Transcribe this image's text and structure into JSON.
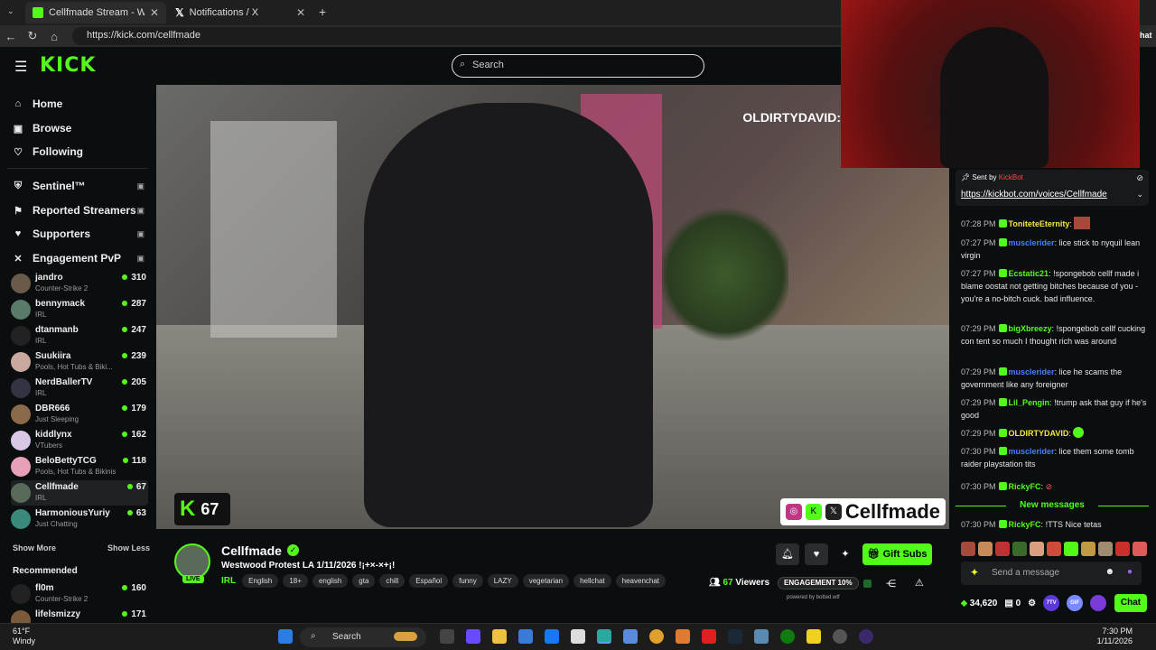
{
  "browser": {
    "tabs": [
      {
        "title": "Cellfmade Stream - Watch Li"
      },
      {
        "title": "Notifications / X"
      }
    ],
    "url": "https://kick.com/cellfmade",
    "right_label": "hat"
  },
  "header": {
    "logo": "KICK",
    "search_placeholder": "Search"
  },
  "sidebar": {
    "nav": [
      {
        "label": "Home",
        "icon": "home-icon"
      },
      {
        "label": "Browse",
        "icon": "browse-icon"
      },
      {
        "label": "Following",
        "icon": "heart-icon"
      }
    ],
    "extensions": [
      {
        "label": "Sentinel™",
        "icon": "shield-icon"
      },
      {
        "label": "Reported Streamers",
        "icon": "flag-icon"
      },
      {
        "label": "Supporters",
        "icon": "heart-icon"
      },
      {
        "label": "Engagement PvP",
        "icon": "swords-icon"
      }
    ],
    "channels": [
      {
        "name": "jandro",
        "category": "Counter-Strike 2",
        "viewers": "310"
      },
      {
        "name": "bennymack",
        "category": "IRL",
        "viewers": "287"
      },
      {
        "name": "dtanmanb",
        "category": "IRL",
        "viewers": "247"
      },
      {
        "name": "Suukiira",
        "category": "Pools, Hot Tubs & Biki...",
        "viewers": "239"
      },
      {
        "name": "NerdBallerTV",
        "category": "IRL",
        "viewers": "205"
      },
      {
        "name": "DBR666",
        "category": "Just Sleeping",
        "viewers": "179"
      },
      {
        "name": "kiddlynx",
        "category": "VTubers",
        "viewers": "162"
      },
      {
        "name": "BeloBettyTCG",
        "category": "Pools, Hot Tubs & Bikinis",
        "viewers": "118"
      },
      {
        "name": "Cellfmade",
        "category": "IRL",
        "viewers": "67"
      },
      {
        "name": "HarmoniousYuriy",
        "category": "Just Chatting",
        "viewers": "63"
      }
    ],
    "show_more": "Show More",
    "show_less": "Show Less",
    "recommended_label": "Recommended",
    "recommended": [
      {
        "name": "fl0m",
        "category": "Counter-Strike 2",
        "viewers": "160"
      },
      {
        "name": "lifelsmizzy",
        "category": "",
        "viewers": "171"
      }
    ]
  },
  "video": {
    "watermark": "OLDIRTYDAVID:",
    "kick_viewer_count": "67",
    "handle": "Cellfmade"
  },
  "stream": {
    "name": "Cellfmade",
    "live_badge": "LIVE",
    "title": "Westwood Protest LA 1/11/2026 !¡+×-×+¡!",
    "category": "IRL",
    "tags": [
      "English",
      "18+",
      "english",
      "gta",
      "chill",
      "Español",
      "funny",
      "LAZY",
      "vegetarian",
      "hellchat",
      "heavenchat"
    ],
    "gift_subs": "Gift Subs",
    "viewers": "67",
    "viewers_label": "Viewers",
    "engagement": "ENGAGEMENT 10%",
    "powered_by": "powered by botted.wtf"
  },
  "chat": {
    "sent_by_label": "Sent by",
    "sent_by_bot": "KickBot",
    "pinned_link": "https://kickbot.com/voices/Cellfmade",
    "messages": [
      {
        "time": "07:28 PM",
        "user": "ToniteteEternity",
        "user_color": "#f5e642",
        "text": ""
      },
      {
        "time": "07:27 PM",
        "user": "musclerider",
        "user_color": "#4a7dff",
        "text": "lice stick to nyquil lean virgin"
      },
      {
        "time": "07:27 PM",
        "user": "Ecstatic21",
        "user_color": "#53fc18",
        "text": "!spongebob cellf made i blame oostat not getting bitches because of you - you're a no-bitch cuck. bad influence."
      },
      {
        "time": "07:29 PM",
        "user": "bigXbreezy",
        "user_color": "#53fc18",
        "text": "!spongebob cellf cucking con tent so much I thought rich was around"
      },
      {
        "time": "07:29 PM",
        "user": "musclerider",
        "user_color": "#4a7dff",
        "text": "lice he scams the government like any foreigner"
      },
      {
        "time": "07:29 PM",
        "user": "Lil_Pengin",
        "user_color": "#53fc18",
        "text": "!trump ask that guy if he's good"
      },
      {
        "time": "07:29 PM",
        "user": "OLDIRTYDAVID",
        "user_color": "#f5e642",
        "text": ""
      },
      {
        "time": "07:30 PM",
        "user": "musclerider",
        "user_color": "#4a7dff",
        "text": "lice them some tomb raider playstation  tits"
      },
      {
        "time": "07:30 PM",
        "user": "RickyFC",
        "user_color": "#53fc18",
        "text": ""
      }
    ],
    "new_messages": "New messages",
    "latest": {
      "time": "07:30 PM",
      "user": "RickyFC",
      "user_color": "#53fc18",
      "text": "!TTS Nice tetas"
    },
    "input_placeholder": "Send a message",
    "points": "34,620",
    "count": "0",
    "chat_button": "Chat",
    "circle1": "7TV",
    "circle2": "GIF"
  },
  "taskbar": {
    "temp": "61°F",
    "weather": "Windy",
    "search": "Search",
    "time": "7:30 PM",
    "date": "1/11/2026"
  }
}
